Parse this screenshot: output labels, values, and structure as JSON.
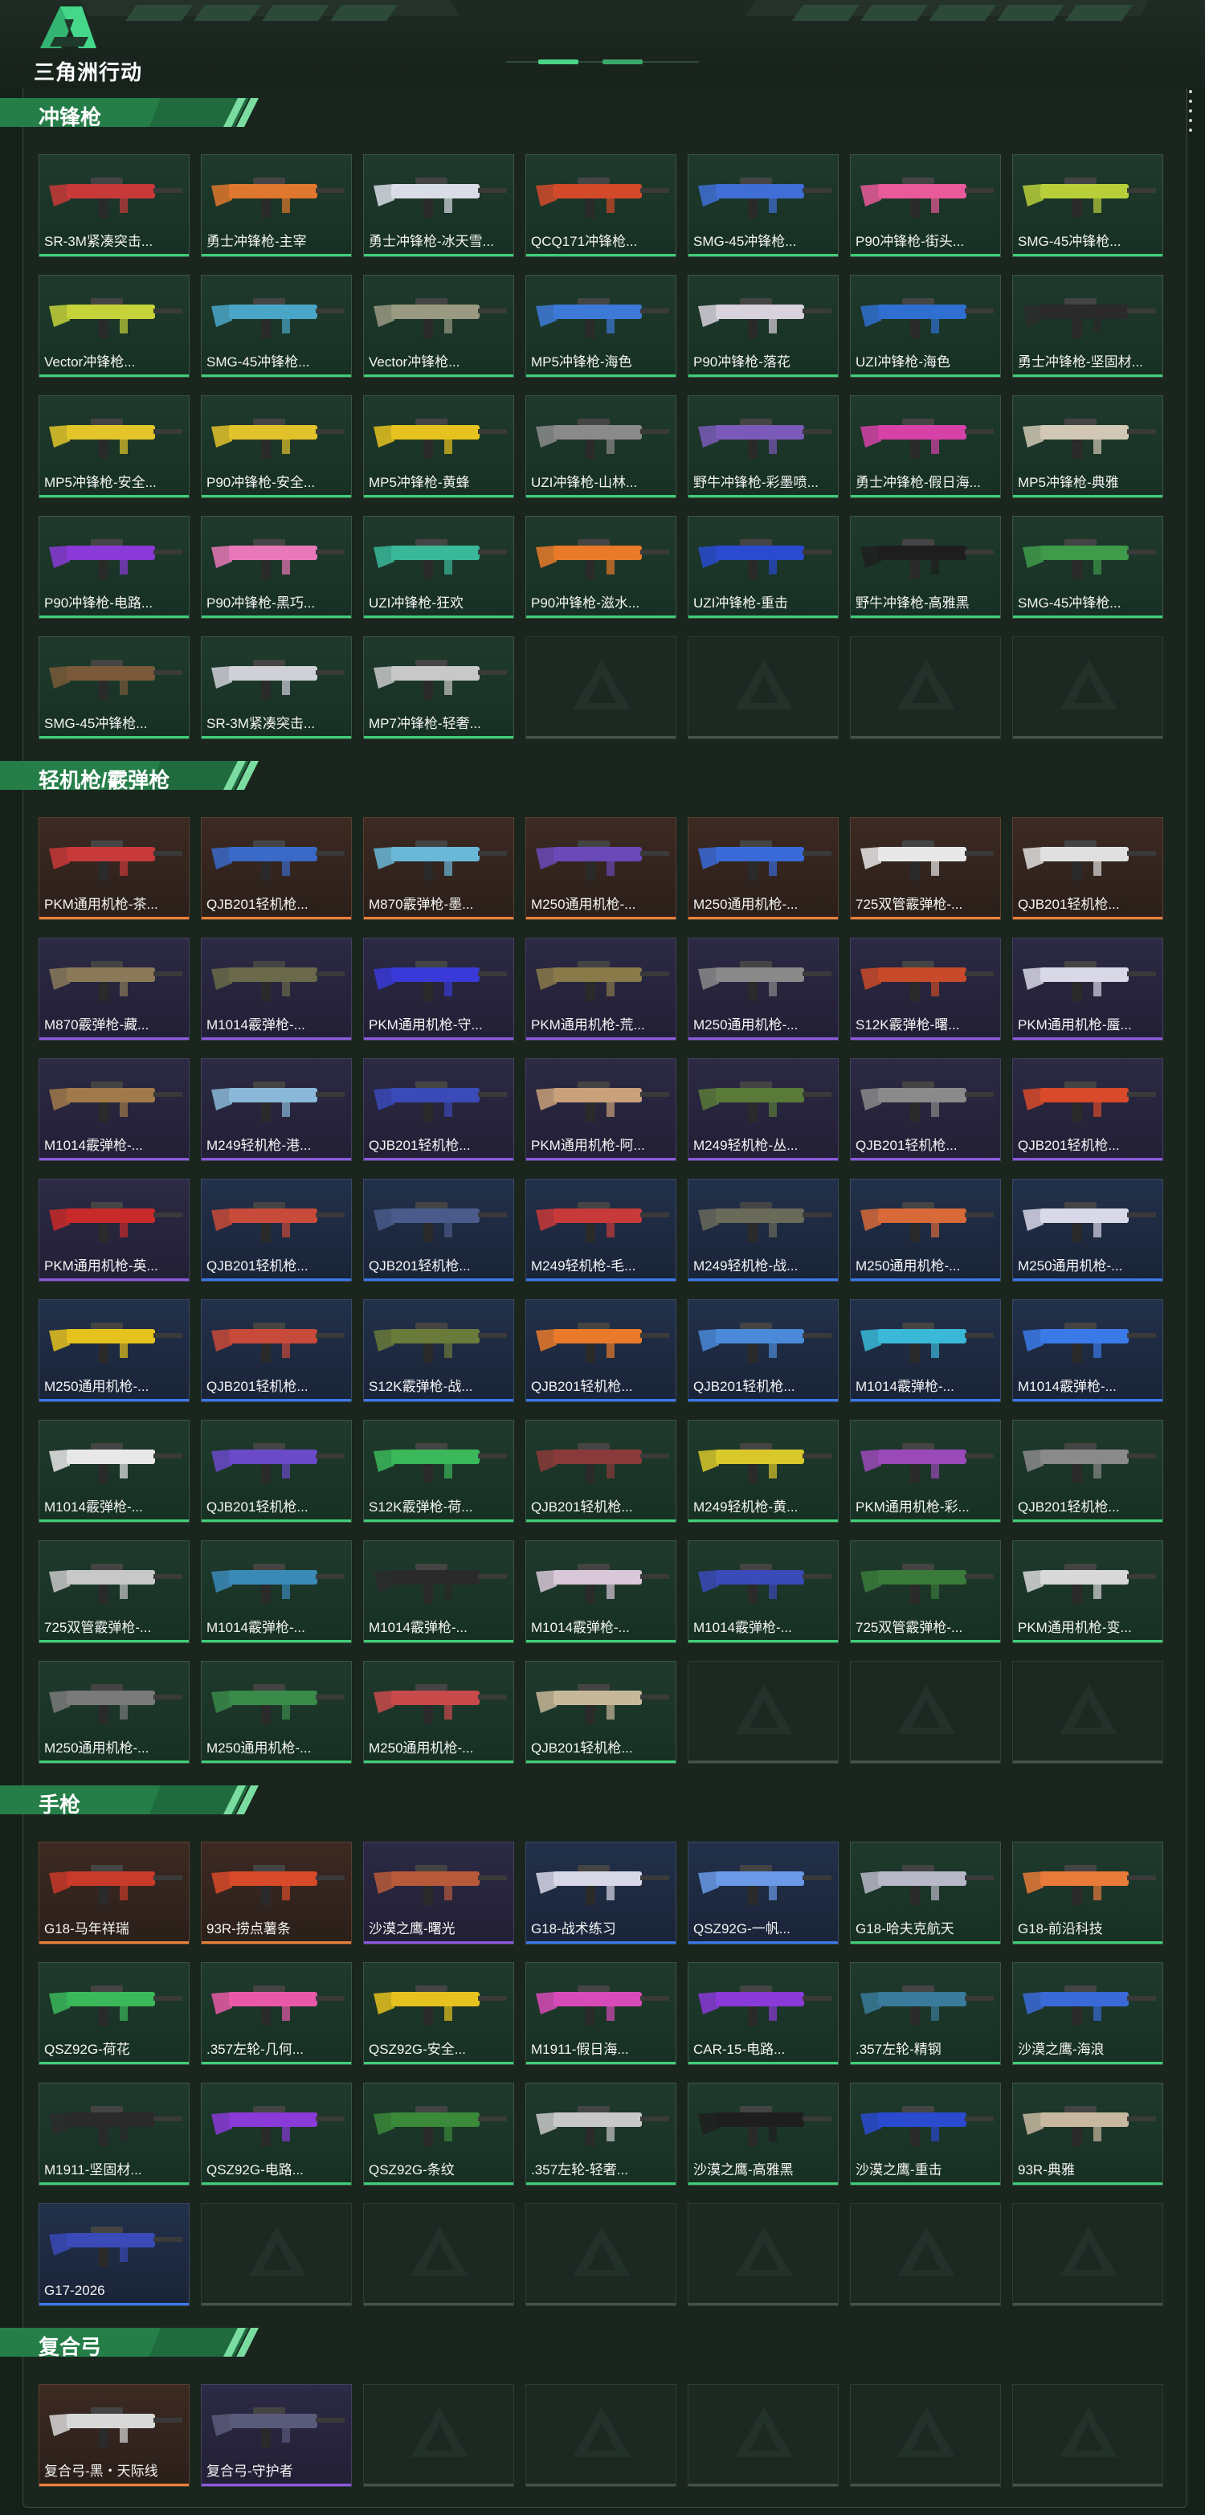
{
  "app": {
    "logo_text": "三角洲行动"
  },
  "sections": [
    {
      "title": "冲锋枪",
      "items": [
        {
          "label": "SR-3M紧凑突击...",
          "rarity": "green",
          "color": "#c83a3a"
        },
        {
          "label": "勇士冲锋枪-主宰",
          "rarity": "green",
          "color": "#e0772e"
        },
        {
          "label": "勇士冲锋枪-冰天雪...",
          "rarity": "green",
          "color": "#d9dde6"
        },
        {
          "label": "QCQ171冲锋枪...",
          "rarity": "green",
          "color": "#d24a2a"
        },
        {
          "label": "SMG-45冲锋枪...",
          "rarity": "green",
          "color": "#3f6fd6"
        },
        {
          "label": "P90冲锋枪-街头...",
          "rarity": "green",
          "color": "#e85a9a"
        },
        {
          "label": "SMG-45冲锋枪...",
          "rarity": "green",
          "color": "#b9cf3a"
        },
        {
          "label": "Vector冲锋枪...",
          "rarity": "green",
          "color": "#c6d23a"
        },
        {
          "label": "SMG-45冲锋枪...",
          "rarity": "green",
          "color": "#4aa6c8"
        },
        {
          "label": "Vector冲锋枪...",
          "rarity": "green",
          "color": "#9a9a82"
        },
        {
          "label": "MP5冲锋枪-海色",
          "rarity": "green",
          "color": "#3d7ad8"
        },
        {
          "label": "P90冲锋枪-落花",
          "rarity": "green",
          "color": "#d8d2dc"
        },
        {
          "label": "UZI冲锋枪-海色",
          "rarity": "green",
          "color": "#2f6fd0"
        },
        {
          "label": "勇士冲锋枪-坚固材...",
          "rarity": "green",
          "color": "#2a2a2a"
        },
        {
          "label": "MP5冲锋枪-安全...",
          "rarity": "green",
          "color": "#e3c52a"
        },
        {
          "label": "P90冲锋枪-安全...",
          "rarity": "green",
          "color": "#e2c22a"
        },
        {
          "label": "MP5冲锋枪-黄蜂",
          "rarity": "green",
          "color": "#e6c21e"
        },
        {
          "label": "UZI冲锋枪-山林...",
          "rarity": "green",
          "color": "#8a8a8a"
        },
        {
          "label": "野牛冲锋枪-彩墨喷...",
          "rarity": "green",
          "color": "#7a5ab8"
        },
        {
          "label": "勇士冲锋枪-假日海...",
          "rarity": "green",
          "color": "#d642a8"
        },
        {
          "label": "MP5冲锋枪-典雅",
          "rarity": "green",
          "color": "#d0c8b4"
        },
        {
          "label": "P90冲锋枪-电路...",
          "rarity": "green",
          "color": "#8a3ad8"
        },
        {
          "label": "P90冲锋枪-黑巧...",
          "rarity": "green",
          "color": "#e878b8"
        },
        {
          "label": "UZI冲锋枪-狂欢",
          "rarity": "green",
          "color": "#3ab89a"
        },
        {
          "label": "P90冲锋枪-滋水...",
          "rarity": "green",
          "color": "#e87a2a"
        },
        {
          "label": "UZI冲锋枪-重击",
          "rarity": "green",
          "color": "#2a4ad0"
        },
        {
          "label": "野牛冲锋枪-高雅黑",
          "rarity": "green",
          "color": "#1e1e1e"
        },
        {
          "label": "SMG-45冲锋枪...",
          "rarity": "green",
          "color": "#3f9a4a"
        },
        {
          "label": "SMG-45冲锋枪...",
          "rarity": "green",
          "color": "#7a5a3a"
        },
        {
          "label": "SR-3M紧凑突击...",
          "rarity": "green",
          "color": "#d0d0d8"
        },
        {
          "label": "MP7冲锋枪-轻奢...",
          "rarity": "green",
          "color": "#c8c8c8"
        }
      ],
      "empty_slots": 4
    },
    {
      "title": "轻机枪/霰弹枪",
      "items": [
        {
          "label": "PKM通用机枪-茶...",
          "rarity": "red",
          "color": "#c83a3a"
        },
        {
          "label": "QJB201轻机枪...",
          "rarity": "red",
          "color": "#3a6ac8"
        },
        {
          "label": "M870霰弹枪-墨...",
          "rarity": "red",
          "color": "#6ab8d8"
        },
        {
          "label": "M250通用机枪-...",
          "rarity": "red",
          "color": "#6a4ab8"
        },
        {
          "label": "M250通用机枪-...",
          "rarity": "red",
          "color": "#3a6ad8"
        },
        {
          "label": "725双管霰弹枪-...",
          "rarity": "red",
          "color": "#e8e8e8"
        },
        {
          "label": "QJB201轻机枪...",
          "rarity": "red",
          "color": "#e0e0e0"
        },
        {
          "label": "M870霰弹枪-藏...",
          "rarity": "purple",
          "color": "#8a7a5a"
        },
        {
          "label": "M1014霰弹枪-...",
          "rarity": "purple",
          "color": "#6a6a4a"
        },
        {
          "label": "PKM通用机枪-守...",
          "rarity": "purple",
          "color": "#3a3ad8"
        },
        {
          "label": "PKM通用机枪-荒...",
          "rarity": "purple",
          "color": "#8a7a4a"
        },
        {
          "label": "M250通用机枪-...",
          "rarity": "purple",
          "color": "#8a8a8a"
        },
        {
          "label": "S12K霰弹枪-曙...",
          "rarity": "purple",
          "color": "#c84a2a"
        },
        {
          "label": "PKM通用机枪-蜃...",
          "rarity": "purple",
          "color": "#d8d8e8"
        },
        {
          "label": "M1014霰弹枪-...",
          "rarity": "purple",
          "color": "#a07a4a"
        },
        {
          "label": "M249轻机枪-港...",
          "rarity": "purple",
          "color": "#8ab8d8"
        },
        {
          "label": "QJB201轻机枪...",
          "rarity": "purple",
          "color": "#3a4ab8"
        },
        {
          "label": "PKM通用机枪-阿...",
          "rarity": "purple",
          "color": "#c8a07a"
        },
        {
          "label": "M249轻机枪-丛...",
          "rarity": "purple",
          "color": "#5a7a3a"
        },
        {
          "label": "QJB201轻机枪...",
          "rarity": "purple",
          "color": "#8a8a8a"
        },
        {
          "label": "QJB201轻机枪...",
          "rarity": "purple",
          "color": "#d84a2a"
        },
        {
          "label": "PKM通用机枪-英...",
          "rarity": "purple",
          "color": "#c82a2a"
        },
        {
          "label": "QJB201轻机枪...",
          "rarity": "blue",
          "color": "#c84a3a"
        },
        {
          "label": "QJB201轻机枪...",
          "rarity": "blue",
          "color": "#4a5a8a"
        },
        {
          "label": "M249轻机枪-毛...",
          "rarity": "blue",
          "color": "#c83a3a"
        },
        {
          "label": "M249轻机枪-战...",
          "rarity": "blue",
          "color": "#6a6a5a"
        },
        {
          "label": "M250通用机枪-...",
          "rarity": "blue",
          "color": "#d86a3a"
        },
        {
          "label": "M250通用机枪-...",
          "rarity": "blue",
          "color": "#d8d8e8"
        },
        {
          "label": "M250通用机枪-...",
          "rarity": "blue",
          "color": "#e6c21e"
        },
        {
          "label": "QJB201轻机枪...",
          "rarity": "blue",
          "color": "#c84a3a"
        },
        {
          "label": "S12K霰弹枪-战...",
          "rarity": "blue",
          "color": "#6a7a3a"
        },
        {
          "label": "QJB201轻机枪...",
          "rarity": "blue",
          "color": "#e87a2a"
        },
        {
          "label": "QJB201轻机枪...",
          "rarity": "blue",
          "color": "#4a8ad8"
        },
        {
          "label": "M1014霰弹枪-...",
          "rarity": "blue",
          "color": "#3ab8d8"
        },
        {
          "label": "M1014霰弹枪-...",
          "rarity": "blue",
          "color": "#3a7ae8"
        },
        {
          "label": "M1014霰弹枪-...",
          "rarity": "green",
          "color": "#e8e8e8"
        },
        {
          "label": "QJB201轻机枪...",
          "rarity": "green",
          "color": "#6a4ac8"
        },
        {
          "label": "S12K霰弹枪-荷...",
          "rarity": "green",
          "color": "#3ab85a"
        },
        {
          "label": "QJB201轻机枪...",
          "rarity": "green",
          "color": "#8a3a3a"
        },
        {
          "label": "M249轻机枪-黄...",
          "rarity": "green",
          "color": "#d8c82a"
        },
        {
          "label": "PKM通用机枪-彩...",
          "rarity": "green",
          "color": "#9a4ab8"
        },
        {
          "label": "QJB201轻机枪...",
          "rarity": "green",
          "color": "#8a8a8a"
        },
        {
          "label": "725双管霰弹枪-...",
          "rarity": "green",
          "color": "#c8c8c8"
        },
        {
          "label": "M1014霰弹枪-...",
          "rarity": "green",
          "color": "#3a8ab8"
        },
        {
          "label": "M1014霰弹枪-...",
          "rarity": "green",
          "color": "#2a2a2a"
        },
        {
          "label": "M1014霰弹枪-...",
          "rarity": "green",
          "color": "#d8c8d8"
        },
        {
          "label": "M1014霰弹枪-...",
          "rarity": "green",
          "color": "#3a4ab8"
        },
        {
          "label": "725双管霰弹枪-...",
          "rarity": "green",
          "color": "#3a7a3a"
        },
        {
          "label": "PKM通用机枪-变...",
          "rarity": "green",
          "color": "#d8d8d8"
        },
        {
          "label": "M250通用机枪-...",
          "rarity": "green",
          "color": "#7a7a7a"
        },
        {
          "label": "M250通用机枪-...",
          "rarity": "green",
          "color": "#3a8a4a"
        },
        {
          "label": "M250通用机枪-...",
          "rarity": "green",
          "color": "#c84a4a"
        },
        {
          "label": "QJB201轻机枪...",
          "rarity": "green",
          "color": "#c8b89a"
        }
      ],
      "empty_slots": 3
    },
    {
      "title": "手枪",
      "items": [
        {
          "label": "G18-马年祥瑞",
          "rarity": "red",
          "color": "#c83a2a"
        },
        {
          "label": "93R-捞点薯条",
          "rarity": "red",
          "color": "#d84a2a"
        },
        {
          "label": "沙漠之鹰-曙光",
          "rarity": "purple",
          "color": "#b85a3a"
        },
        {
          "label": "G18-战术练习",
          "rarity": "blue",
          "color": "#d8d8e8"
        },
        {
          "label": "QSZ92G-一帆...",
          "rarity": "blue",
          "color": "#6a9ae8"
        },
        {
          "label": "G18-哈夫克航天",
          "rarity": "green",
          "color": "#b8b8c8"
        },
        {
          "label": "G18-前沿科技",
          "rarity": "green",
          "color": "#e87a3a"
        },
        {
          "label": "QSZ92G-荷花",
          "rarity": "green",
          "color": "#3ab85a"
        },
        {
          "label": ".357左轮-几何...",
          "rarity": "green",
          "color": "#e85aa8"
        },
        {
          "label": "QSZ92G-安全...",
          "rarity": "green",
          "color": "#e6c21e"
        },
        {
          "label": "M1911-假日海...",
          "rarity": "green",
          "color": "#d84ab8"
        },
        {
          "label": "CAR-15-电路...",
          "rarity": "green",
          "color": "#8a3ad8"
        },
        {
          "label": ".357左轮-精钢",
          "rarity": "green",
          "color": "#3a7a9a"
        },
        {
          "label": "沙漠之鹰-海浪",
          "rarity": "green",
          "color": "#3a6ad8"
        },
        {
          "label": "M1911-坚固材...",
          "rarity": "green",
          "color": "#2a2a2a"
        },
        {
          "label": "QSZ92G-电路...",
          "rarity": "green",
          "color": "#8a3ad8"
        },
        {
          "label": "QSZ92G-条纹",
          "rarity": "green",
          "color": "#3a8a3a"
        },
        {
          "label": ".357左轮-轻奢...",
          "rarity": "green",
          "color": "#c8c8c8"
        },
        {
          "label": "沙漠之鹰-高雅黑",
          "rarity": "green",
          "color": "#1e1e1e"
        },
        {
          "label": "沙漠之鹰-重击",
          "rarity": "green",
          "color": "#2a4ad0"
        },
        {
          "label": "93R-典雅",
          "rarity": "green",
          "color": "#c8b8a0"
        },
        {
          "label": "G17-2026",
          "rarity": "blue",
          "color": "#3a4ab8"
        }
      ],
      "empty_slots": 6
    },
    {
      "title": "复合弓",
      "items": [
        {
          "label": "复合弓-黑・天际线",
          "rarity": "red",
          "color": "#d8d8d8"
        },
        {
          "label": "复合弓-守护者",
          "rarity": "purple",
          "color": "#5a5a7a"
        }
      ],
      "empty_slots": 5
    }
  ]
}
